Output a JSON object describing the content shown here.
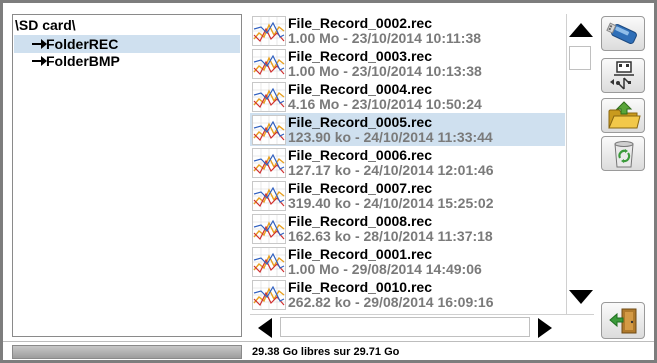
{
  "tree": {
    "root": "\\SD card\\",
    "items": [
      {
        "label": "FolderREC",
        "selected": true
      },
      {
        "label": "FolderBMP",
        "selected": false
      }
    ]
  },
  "files": [
    {
      "name": "File_Record_0002.rec",
      "info": "1.00 Mo - 23/10/2014 10:11:38",
      "selected": false
    },
    {
      "name": "File_Record_0003.rec",
      "info": "1.00 Mo - 23/10/2014 10:13:38",
      "selected": false
    },
    {
      "name": "File_Record_0004.rec",
      "info": "4.16 Mo - 23/10/2014 10:50:24",
      "selected": false
    },
    {
      "name": "File_Record_0005.rec",
      "info": "123.90 ko - 24/10/2014 11:33:44",
      "selected": true
    },
    {
      "name": "File_Record_0006.rec",
      "info": "127.17 ko - 24/10/2014 12:01:46",
      "selected": false
    },
    {
      "name": "File_Record_0007.rec",
      "info": "319.40 ko - 24/10/2014 15:25:02",
      "selected": false
    },
    {
      "name": "File_Record_0008.rec",
      "info": "162.63 ko - 28/10/2014 11:37:18",
      "selected": false
    },
    {
      "name": "File_Record_0001.rec",
      "info": "1.00 Mo - 29/08/2014 14:49:06",
      "selected": false
    },
    {
      "name": "File_Record_0010.rec",
      "info": "262.82 ko - 29/08/2014 16:09:16",
      "selected": false
    }
  ],
  "toolbar": {
    "buttons": [
      {
        "name": "usb-drive-button",
        "icon": "usb-drive-icon"
      },
      {
        "name": "usb-transfer-button",
        "icon": "usb-transfer-icon"
      },
      {
        "name": "open-folder-button",
        "icon": "folder-open-icon"
      },
      {
        "name": "recycle-bin-button",
        "icon": "recycle-bin-icon"
      }
    ],
    "exit_icon": "exit-door-icon"
  },
  "status": {
    "free_space_text": "29.38 Go libres sur 29.71 Go"
  },
  "colors": {
    "selection": "#cfe0ef",
    "info_text": "#7a7a7a",
    "frame": "#7d7d7d"
  }
}
